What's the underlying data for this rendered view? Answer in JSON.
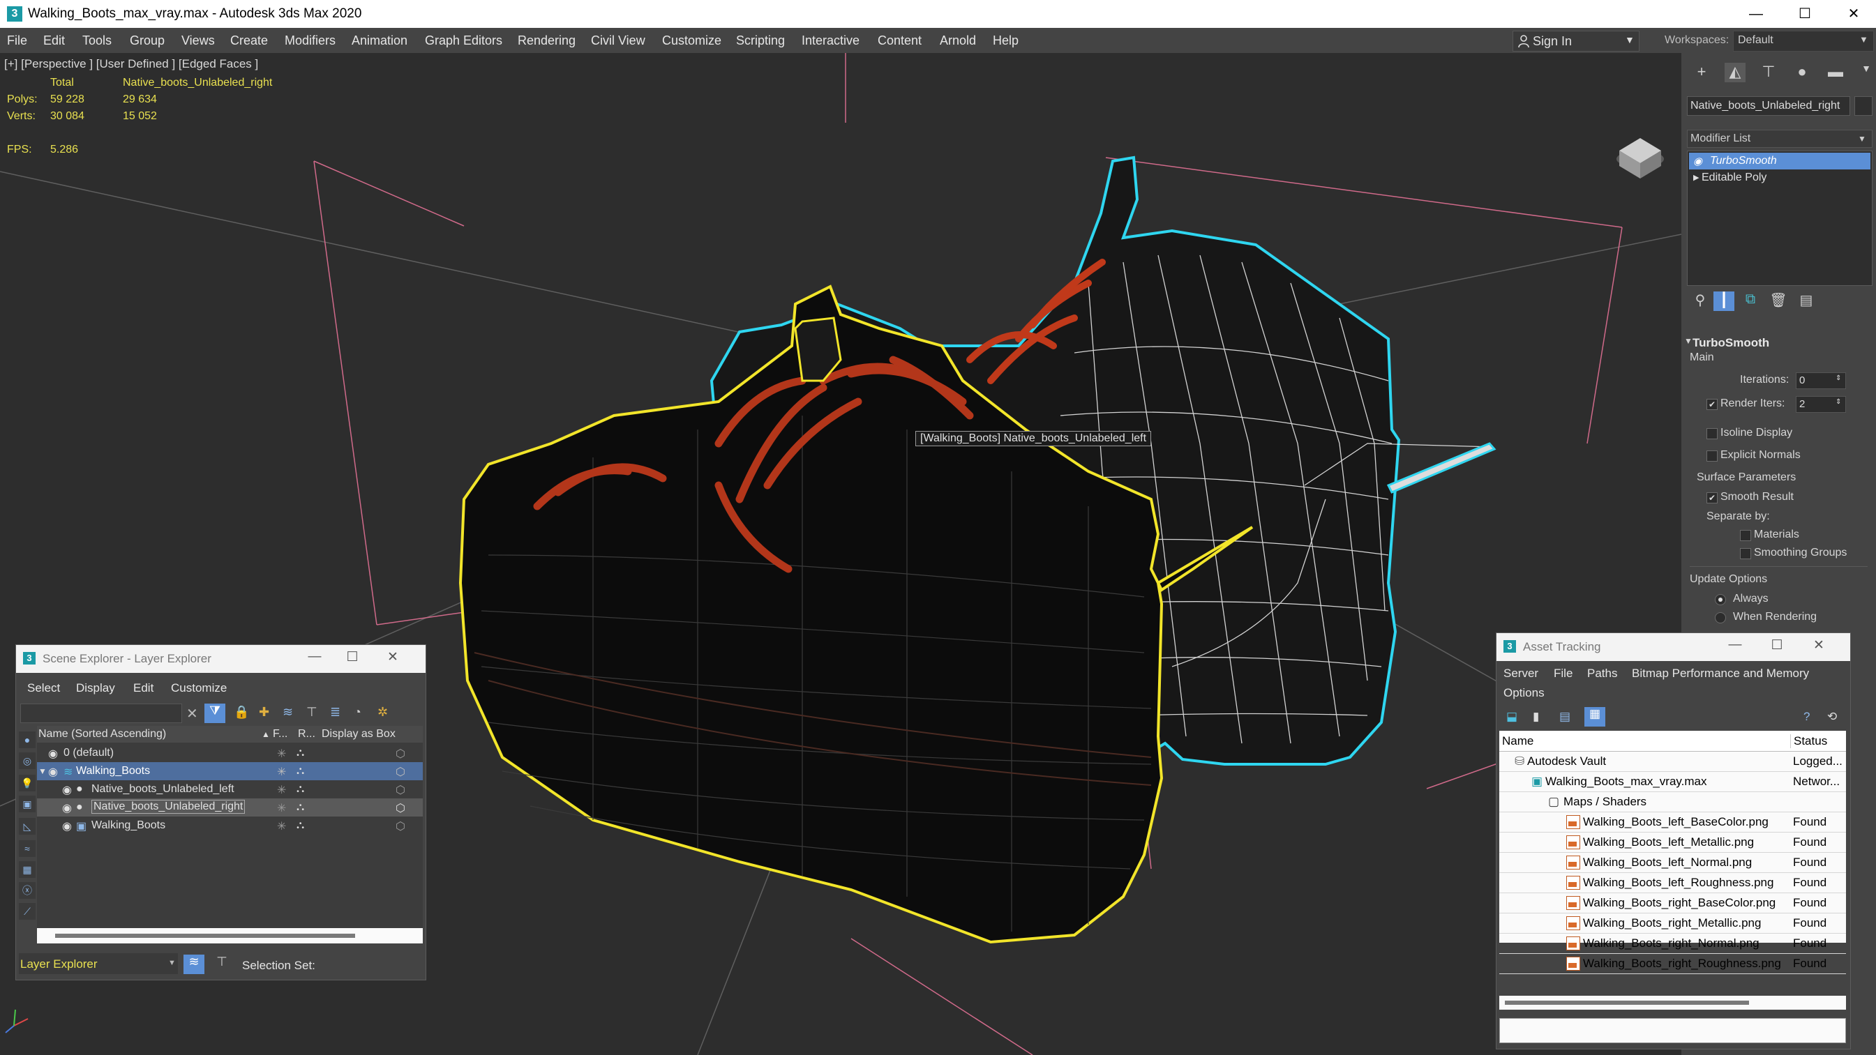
{
  "window": {
    "title": "Walking_Boots_max_vray.max - Autodesk 3ds Max 2020",
    "app_icon": "3",
    "minimize": "—",
    "maximize": "☐",
    "close": "✕"
  },
  "menu": {
    "items": [
      "File",
      "Edit",
      "Tools",
      "Group",
      "Views",
      "Create",
      "Modifiers",
      "Animation",
      "Graph Editors",
      "Rendering",
      "Civil View",
      "Customize",
      "Scripting",
      "Interactive",
      "Content",
      "Arnold",
      "Help"
    ],
    "sign_in": "Sign In",
    "workspaces_label": "Workspaces:",
    "workspace_value": "Default"
  },
  "viewport": {
    "label": "[+] [Perspective ] [User Defined ] [Edged Faces ]",
    "stats": {
      "col_total": "Total",
      "col_object": "Native_boots_Unlabeled_right",
      "polys_label": "Polys:",
      "polys_total": "59 228",
      "polys_object": "29 634",
      "verts_label": "Verts:",
      "verts_total": "30 084",
      "verts_object": "15 052",
      "fps_label": "FPS:",
      "fps_value": "5.286"
    },
    "tooltip": "[Walking_Boots] Native_boots_Unlabeled_left",
    "colors": {
      "selected_outline": "#f2e52a",
      "secondary_outline": "#2fd6f0",
      "laces": "#c0391a",
      "wire": "#ffffff",
      "grid": "#d06a8a"
    }
  },
  "command_panel": {
    "object_name": "Native_boots_Unlabeled_right",
    "modifier_list": "Modifier List",
    "stack": [
      "TurboSmooth",
      "Editable Poly"
    ],
    "turbosmooth": {
      "title": "TurboSmooth",
      "main": "Main",
      "iterations_label": "Iterations:",
      "iterations_value": "0",
      "render_iters_label": "Render Iters:",
      "render_iters_value": "2",
      "render_iters_checked": true,
      "isoline_display": "Isoline Display",
      "explicit_normals": "Explicit Normals",
      "surface_parameters": "Surface Parameters",
      "smooth_result": "Smooth Result",
      "separate_by": "Separate by:",
      "materials": "Materials",
      "smoothing_groups": "Smoothing Groups",
      "update_options": "Update Options",
      "always": "Always",
      "when_rendering": "When Rendering"
    }
  },
  "scene_explorer": {
    "title": "Scene Explorer - Layer Explorer",
    "menus": [
      "Select",
      "Display",
      "Edit",
      "Customize"
    ],
    "columns": {
      "name": "Name (Sorted Ascending)",
      "frozen": "F...",
      "renderable": "R...",
      "box": "Display as Box"
    },
    "rows": [
      {
        "label": "0 (default)",
        "indent": 1
      },
      {
        "label": "Walking_Boots",
        "indent": 1,
        "highlight": true
      },
      {
        "label": "Native_boots_Unlabeled_left",
        "indent": 2
      },
      {
        "label": "Native_boots_Unlabeled_right",
        "indent": 2,
        "selected": true
      },
      {
        "label": "Walking_Boots",
        "indent": 2
      }
    ],
    "footer_dropdown": "Layer Explorer",
    "selection_set": "Selection Set:"
  },
  "asset_tracking": {
    "title": "Asset Tracking",
    "menus": [
      "Server",
      "File",
      "Paths",
      "Bitmap Performance and Memory"
    ],
    "menu_row2": "Options",
    "columns": {
      "name": "Name",
      "status": "Status"
    },
    "rows": [
      {
        "name": "Autodesk Vault",
        "status": "Logged...",
        "indent": 0,
        "type": "vault"
      },
      {
        "name": "Walking_Boots_max_vray.max",
        "status": "Networ...",
        "indent": 1,
        "type": "max"
      },
      {
        "name": "Maps / Shaders",
        "status": "",
        "indent": 2,
        "type": "folder"
      },
      {
        "name": "Walking_Boots_left_BaseColor.png",
        "status": "Found",
        "indent": 3,
        "type": "png"
      },
      {
        "name": "Walking_Boots_left_Metallic.png",
        "status": "Found",
        "indent": 3,
        "type": "png"
      },
      {
        "name": "Walking_Boots_left_Normal.png",
        "status": "Found",
        "indent": 3,
        "type": "png"
      },
      {
        "name": "Walking_Boots_left_Roughness.png",
        "status": "Found",
        "indent": 3,
        "type": "png"
      },
      {
        "name": "Walking_Boots_right_BaseColor.png",
        "status": "Found",
        "indent": 3,
        "type": "png"
      },
      {
        "name": "Walking_Boots_right_Metallic.png",
        "status": "Found",
        "indent": 3,
        "type": "png"
      },
      {
        "name": "Walking_Boots_right_Normal.png",
        "status": "Found",
        "indent": 3,
        "type": "png"
      },
      {
        "name": "Walking_Boots_right_Roughness.png",
        "status": "Found",
        "indent": 3,
        "type": "png"
      }
    ]
  }
}
